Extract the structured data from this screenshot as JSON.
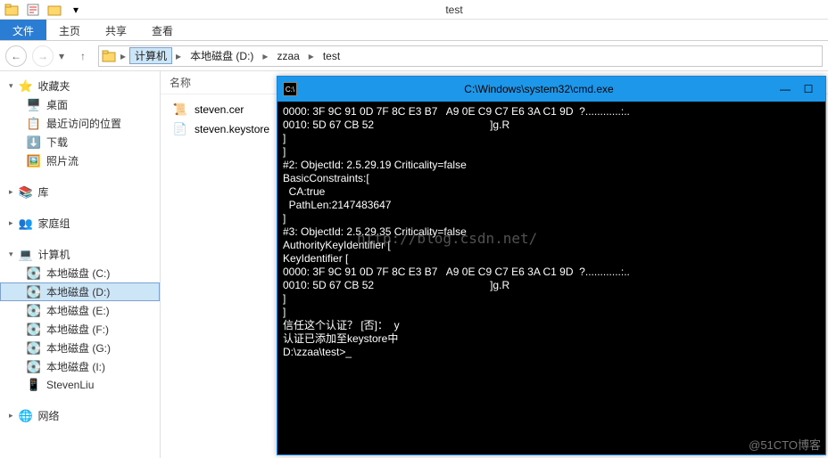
{
  "window_title": "test",
  "ribbon": {
    "file": "文件",
    "home": "主页",
    "share": "共享",
    "view": "查看"
  },
  "breadcrumb": [
    "计算机",
    "本地磁盘 (D:)",
    "zzaa",
    "test"
  ],
  "sidebar": {
    "favorites": {
      "title": "收藏夹",
      "items": [
        "桌面",
        "最近访问的位置",
        "下载",
        "照片流"
      ]
    },
    "libraries": {
      "title": "库"
    },
    "homegroup": {
      "title": "家庭组"
    },
    "computer": {
      "title": "计算机",
      "items": [
        "本地磁盘 (C:)",
        "本地磁盘 (D:)",
        "本地磁盘 (E:)",
        "本地磁盘 (F:)",
        "本地磁盘 (G:)",
        "本地磁盘 (I:)",
        "StevenLiu"
      ]
    },
    "network": {
      "title": "网络"
    }
  },
  "column_header": "名称",
  "files": [
    "steven.cer",
    "steven.keystore"
  ],
  "cmd": {
    "title": "C:\\Windows\\system32\\cmd.exe",
    "lines": [
      "0000: 3F 9C 91 0D 7F 8C E3 B7   A9 0E C9 C7 E6 3A C1 9D  ?............:..",
      "0010: 5D 67 CB 52                                       ]g.R",
      "]",
      "]",
      "",
      "#2: ObjectId: 2.5.29.19 Criticality=false",
      "BasicConstraints:[",
      "  CA:true",
      "  PathLen:2147483647",
      "]",
      "",
      "#3: ObjectId: 2.5.29.35 Criticality=false",
      "AuthorityKeyIdentifier [",
      "KeyIdentifier [",
      "0000: 3F 9C 91 0D 7F 8C E3 B7   A9 0E C9 C7 E6 3A C1 9D  ?............:..",
      "0010: 5D 67 CB 52                                       ]g.R",
      "]",
      "]",
      "",
      "",
      "",
      "信任这个认证？ [否]：  y",
      "认证已添加至keystore中",
      "",
      "D:\\zzaa\\test>_"
    ]
  },
  "watermark_center": "http://blog.csdn.net/",
  "watermark_corner": "@51CTO博客"
}
